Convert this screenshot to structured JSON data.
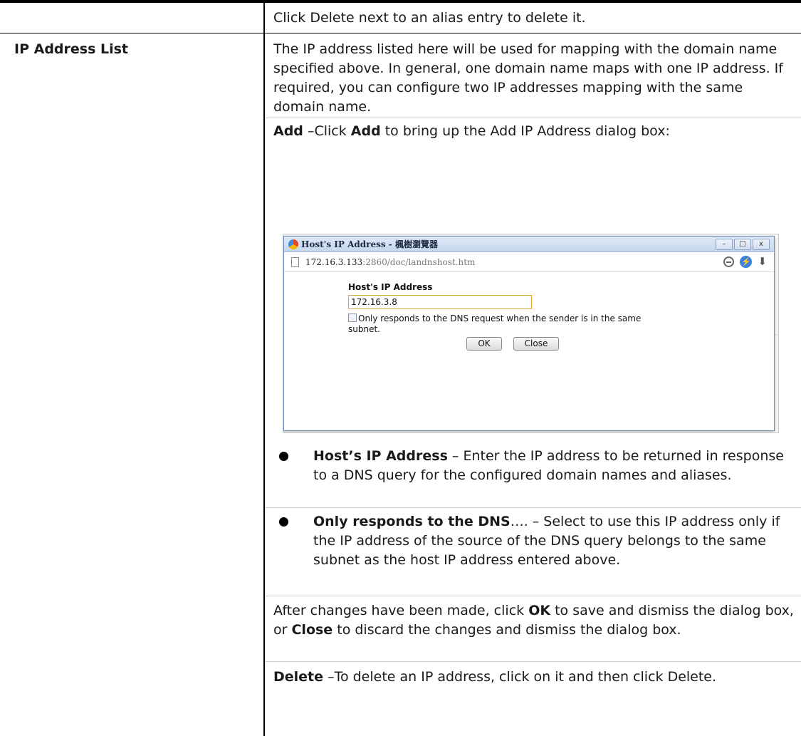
{
  "row_prev": {
    "text": "Click Delete next to an alias entry to delete it."
  },
  "ip_list": {
    "label": "IP Address List",
    "intro": "The IP address listed here will be used for mapping with the domain name specified above. In general, one domain name maps with one IP address. If required, you can configure two IP addresses mapping with the same domain name.",
    "add_keyword": "Add",
    "add_text_1": " –Click ",
    "add_keyword_2": "Add",
    "add_text_2": " to bring up the Add IP Address dialog box:",
    "bullets": [
      {
        "term": "Host’s IP Address",
        "text": " – Enter the IP address to be returned in response to a DNS query for the configured domain names and aliases."
      },
      {
        "term": "Only responds to the DNS",
        "text": "…. – Select to use this IP address only if the IP address of the source of the DNS query belongs to the same subnet as the host IP address entered above."
      }
    ],
    "after_1": "After changes have been made, click ",
    "after_ok": "OK",
    "after_2": " to save and dismiss the dialog box, or ",
    "after_close": "Close",
    "after_3": " to discard the changes and dismiss the dialog box.",
    "delete_keyword": "Delete",
    "delete_text": " –To delete an IP address, click on it and then click Delete."
  },
  "dialog": {
    "title": "Host's IP Address - 楓樹瀏覽器",
    "url_host": "172.16.3.133",
    "url_rest": ":2860/doc/landnshost.htm",
    "field_label": "Host's IP Address",
    "field_value": "172.16.3.8",
    "checkbox_label": "Only responds to the DNS request when the sender is in the same subnet.",
    "ok_label": "OK",
    "close_label": "Close",
    "window_buttons": {
      "minimize": "–",
      "maximize": "□",
      "close": "x"
    }
  }
}
